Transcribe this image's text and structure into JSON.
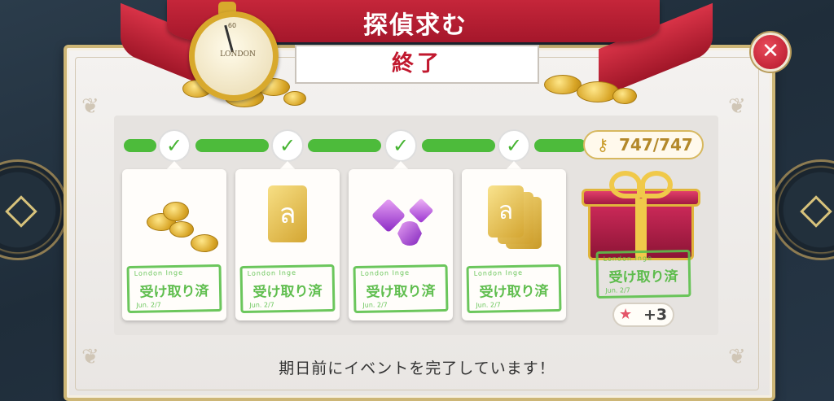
{
  "header": {
    "title": "探偵求む",
    "status": "終了"
  },
  "stopwatch": {
    "dial_number": "60",
    "brand_text": "LONDON"
  },
  "progress": {
    "current": "747",
    "max": "747",
    "separator": "/",
    "completed_steps": 4
  },
  "rewards": [
    {
      "item": "gold-coins",
      "stamp": "受け取り済",
      "stamp_top": "London Inge",
      "stamp_bottom": "Jun. 2/7"
    },
    {
      "item": "golden-ticket",
      "stamp": "受け取り済",
      "stamp_top": "London Inge",
      "stamp_bottom": "Jun. 2/7"
    },
    {
      "item": "purple-gems",
      "stamp": "受け取り済",
      "stamp_top": "London Inge",
      "stamp_bottom": "Jun. 2/7"
    },
    {
      "item": "golden-tickets-stack",
      "stamp": "受け取り済",
      "stamp_top": "London Inge",
      "stamp_bottom": "Jun. 2/7"
    }
  ],
  "final_reward": {
    "item": "gift-box",
    "stamp": "受け取り済",
    "stamp_top": "London Inge",
    "stamp_bottom": "Jun. 2/7",
    "bonus": "+3"
  },
  "footer": {
    "message": "期日前にイベントを完了しています！"
  },
  "colors": {
    "ribbon": "#c5263a",
    "progress": "#4dbb3b",
    "stamp": "#5cc14b",
    "gold": "#d8a92c"
  }
}
